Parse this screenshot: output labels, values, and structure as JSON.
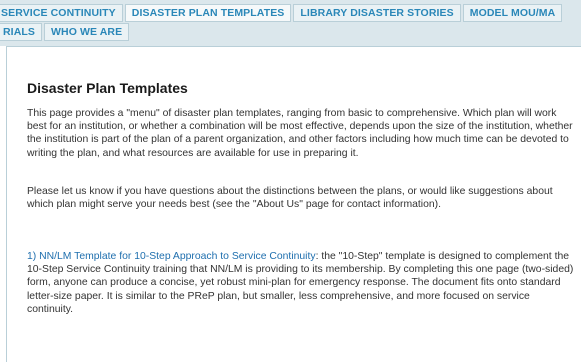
{
  "nav": {
    "row1": [
      {
        "label": "SERVICE CONTINUITY",
        "active": false
      },
      {
        "label": "DISASTER PLAN TEMPLATES",
        "active": true
      },
      {
        "label": "LIBRARY DISASTER STORIES",
        "active": false
      },
      {
        "label": "MODEL MOU/MA",
        "active": false
      }
    ],
    "row2": [
      {
        "label": "RIALS",
        "active": false
      },
      {
        "label": "WHO WE ARE",
        "active": false
      }
    ]
  },
  "page": {
    "title": "Disaster Plan Templates",
    "intro": "This page provides a \"menu\" of disaster plan templates, ranging from basic to comprehensive. Which plan will work best for an institution, or whether a combination will be most effective, depends upon the size of the institution, whether the institution is part of the plan of a parent organization, and other factors including how much time can be devoted to writing the plan, and what resources are available for use in preparing it.",
    "contact": "Please let us know if you have questions about the distinctions between the plans, or would like suggestions about which plan might serve your needs best (see the \"About Us\" page for contact information).",
    "item1_link": "1) NN/LM Template for 10-Step Approach to Service Continuity",
    "item1_text": ": the \"10-Step\" template is designed to complement the 10-Step Service Continuity training that NN/LM is providing to its membership. By completing this one page (two-sided) form, anyone can produce a concise, yet robust mini-plan for emergency response. The document fits onto standard letter-size paper. It is similar to the PReP plan, but smaller, less comprehensive, and more focused on service continuity."
  }
}
